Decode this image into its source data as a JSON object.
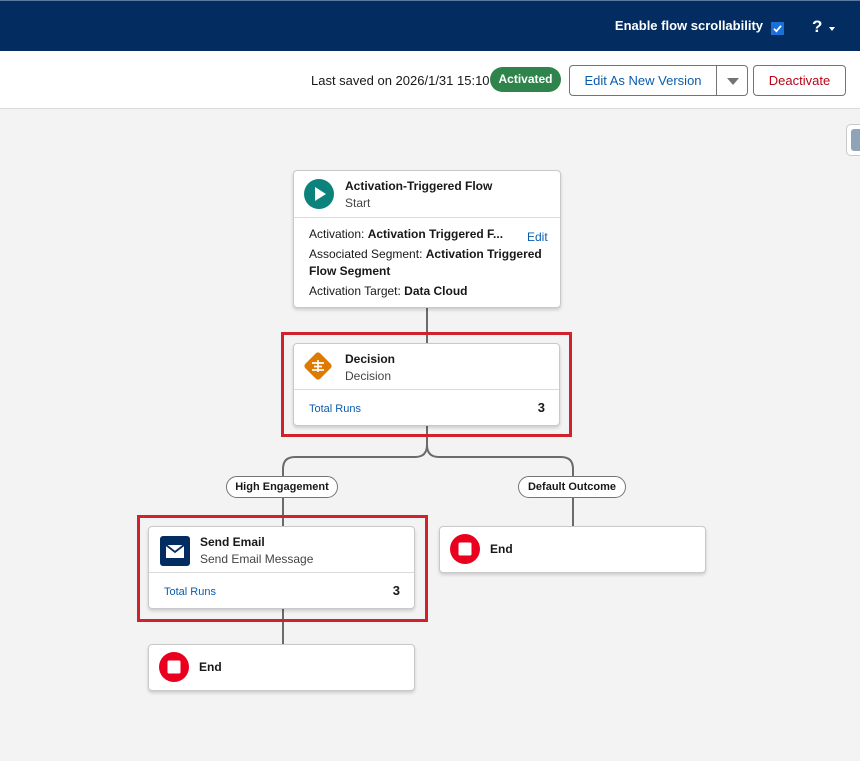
{
  "header": {
    "scroll_label": "Enable flow scrollability",
    "scroll_checked": true,
    "help_label": "?"
  },
  "toolbar": {
    "saved_text": "Last saved on 2026/1/31 15:10",
    "status_badge": "Activated",
    "edit_version_label": "Edit As New Version",
    "deactivate_label": "Deactivate"
  },
  "colors": {
    "header_bg": "#032d60",
    "activated_green": "#2e844a",
    "link_blue": "#0b5cab",
    "deactivate_red": "#ba0517",
    "highlight_red": "#d0222c",
    "start_icon_teal": "#0b827c",
    "decision_icon_orange": "#dd7a01",
    "email_icon_navy": "#032d60",
    "end_icon_red": "#ea001e"
  },
  "flow": {
    "start": {
      "icon": "play-icon",
      "title": "Activation-Triggered Flow",
      "subtitle": "Start",
      "activation_label": "Activation: ",
      "activation_value": "Activation Triggered F...",
      "edit_label": "Edit",
      "segment_label": "Associated Segment: ",
      "segment_value": "Activation Triggered Flow Segment",
      "target_label": "Activation Target: ",
      "target_value": "Data Cloud"
    },
    "decision": {
      "icon": "decision-icon",
      "title": "Decision",
      "subtitle": "Decision",
      "runs_label": "Total Runs",
      "runs_value": "3"
    },
    "branches": {
      "left_label": "High Engagement",
      "right_label": "Default Outcome"
    },
    "send_email": {
      "icon": "email-icon",
      "title": "Send Email",
      "subtitle": "Send Email Message",
      "runs_label": "Total Runs",
      "runs_value": "3"
    },
    "end_right": {
      "icon": "stop-icon",
      "title": "End"
    },
    "end_bottom": {
      "icon": "stop-icon",
      "title": "End"
    }
  }
}
